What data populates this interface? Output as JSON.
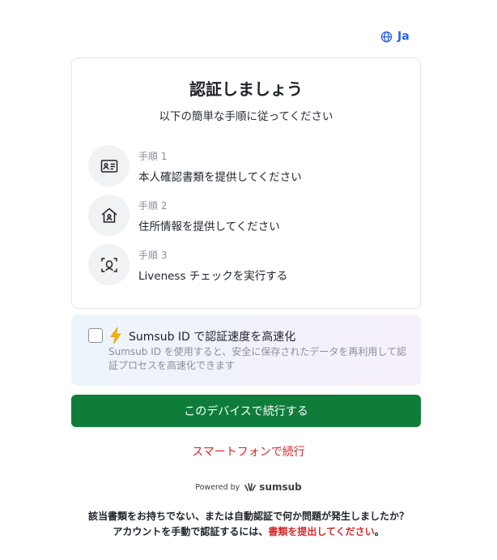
{
  "language": {
    "label": "Ja",
    "icon": "globe-icon"
  },
  "card": {
    "title": "認証しましょう",
    "subtitle": "以下の簡単な手順に従ってください",
    "steps": [
      {
        "label": "手順 1",
        "text": "本人確認書類を提供してください",
        "icon": "id-card-icon"
      },
      {
        "label": "手順 2",
        "text": "住所情報を提供してください",
        "icon": "home-icon"
      },
      {
        "label": "手順 3",
        "text": "Liveness チェックを実行する",
        "icon": "face-scan-icon"
      }
    ]
  },
  "reuse": {
    "title": "Sumsub ID で認証速度を高速化",
    "description": "Sumsub ID を使用すると、安全に保存されたデータを再利用して認証プロセスを高速化できます",
    "checked": false
  },
  "actions": {
    "primary": "このデバイスで続行する",
    "secondary": "スマートフォンで続行"
  },
  "powered_by": {
    "label": "Powered by",
    "brand": "sumsub"
  },
  "footer": {
    "line1": "該当書類をお持ちでない、または自動認証で何か問題が発生しましたか？",
    "line2_prefix": "アカウントを手動で認証するには、",
    "line2_link": "書類を提出してください",
    "line2_suffix": "。"
  },
  "colors": {
    "accent": "#0f7d3a",
    "link": "#d72a2a",
    "language": "#2563eb"
  }
}
